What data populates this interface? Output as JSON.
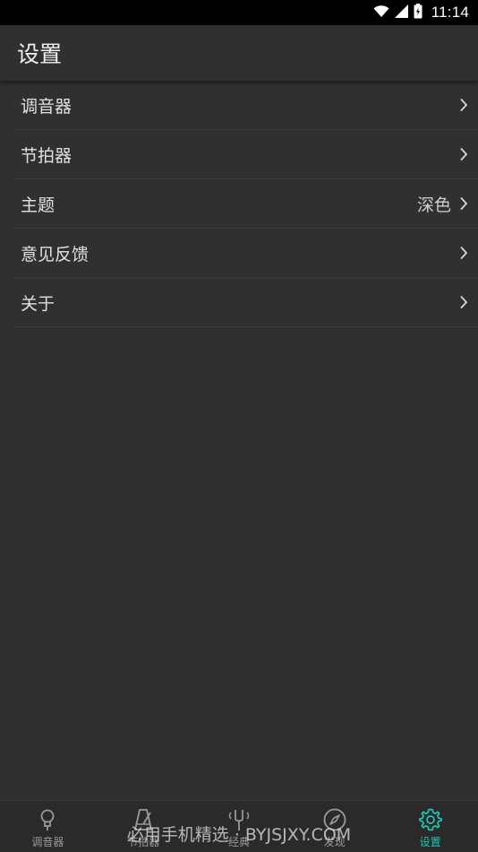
{
  "status_bar": {
    "time": "11:14"
  },
  "header": {
    "title": "设置"
  },
  "settings": {
    "items": [
      {
        "label": "调音器",
        "value": ""
      },
      {
        "label": "节拍器",
        "value": ""
      },
      {
        "label": "主题",
        "value": "深色"
      },
      {
        "label": "意见反馈",
        "value": ""
      },
      {
        "label": "关于",
        "value": ""
      }
    ]
  },
  "bottom_nav": {
    "items": [
      {
        "label": "调音器",
        "icon": "tuner-icon"
      },
      {
        "label": "节拍器",
        "icon": "metronome-icon"
      },
      {
        "label": "经典",
        "icon": "tuning-fork-icon"
      },
      {
        "label": "发现",
        "icon": "compass-icon"
      },
      {
        "label": "设置",
        "icon": "gear-icon",
        "active": true
      }
    ]
  },
  "watermark": {
    "text": "必用手机精选 · BYJSJXY.COM"
  },
  "colors": {
    "accent": "#1fc7b6",
    "background": "#303030",
    "status_bar": "#000000"
  }
}
